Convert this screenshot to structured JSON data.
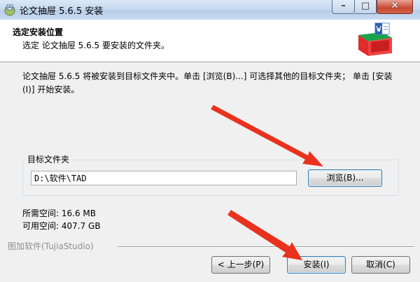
{
  "window": {
    "title": "论文抽屉 5.6.5 安装"
  },
  "header": {
    "title": "选定安装位置",
    "subtitle": "选定 论文抽屉 5.6.5 要安装的文件夹。"
  },
  "body": {
    "description": "论文抽屉 5.6.5 将被安装到目标文件夹中。单击 [浏览(B)...] 可选择其他的目标文件夹； 单击 [安装(I)] 开始安装。",
    "group_label": "目标文件夹",
    "path_value": "D:\\软件\\TAD",
    "browse_label": "浏览(B)...",
    "space_required": "所需空间: 16.6 MB",
    "space_available": "可用空间: 407.7 GB"
  },
  "footer": {
    "brand": "图加软件(TujiaStudio)",
    "back_label": "< 上一步(P)",
    "install_label": "安装(I)",
    "cancel_label": "取消(C)"
  },
  "colors": {
    "arrow": "#e8321e",
    "header_bg": "#ffffff",
    "titlebar": "#c5d8ee",
    "close_button": "#c74a33"
  }
}
